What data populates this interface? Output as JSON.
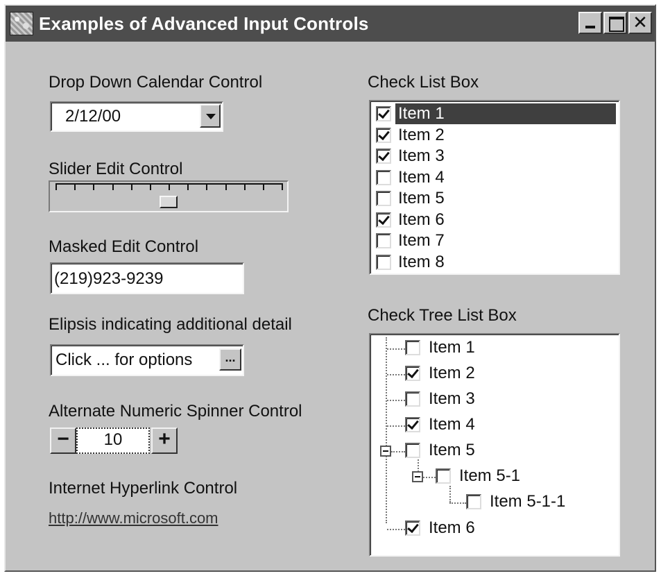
{
  "window": {
    "title": "Examples of Advanced Input Controls"
  },
  "date_control": {
    "label": "Drop Down Calendar Control",
    "value": "2/12/00"
  },
  "slider_control": {
    "label": "Slider Edit Control",
    "tick_count": 13,
    "position_fraction": 0.5
  },
  "masked_edit": {
    "label": "Masked Edit Control",
    "value": "(219)923-9239"
  },
  "ellipsis_control": {
    "label": "Elipsis indicating additional detail",
    "value": "Click ... for options",
    "button_label": "..."
  },
  "spinner": {
    "label": "Alternate Numeric Spinner Control",
    "value": "10",
    "minus_label": "−",
    "plus_label": "+"
  },
  "hyperlink": {
    "label": "Internet Hyperlink Control",
    "url": "http://www.microsoft.com"
  },
  "check_list_box": {
    "label": "Check List Box",
    "items": [
      {
        "label": "Item 1",
        "checked": true,
        "selected": true
      },
      {
        "label": "Item 2",
        "checked": true,
        "selected": false
      },
      {
        "label": "Item 3",
        "checked": true,
        "selected": false
      },
      {
        "label": "Item 4",
        "checked": false,
        "selected": false
      },
      {
        "label": "Item 5",
        "checked": false,
        "selected": false
      },
      {
        "label": "Item 6",
        "checked": true,
        "selected": false
      },
      {
        "label": "Item 7",
        "checked": false,
        "selected": false
      },
      {
        "label": "Item 8",
        "checked": false,
        "selected": false
      }
    ]
  },
  "check_tree_list_box": {
    "label": "Check Tree List Box",
    "items": [
      {
        "label": "Item 1",
        "checked": false
      },
      {
        "label": "Item 2",
        "checked": true
      },
      {
        "label": "Item 3",
        "checked": false
      },
      {
        "label": "Item 4",
        "checked": true
      },
      {
        "label": "Item 5",
        "checked": false,
        "expanded": true
      },
      {
        "label": "Item 5-1",
        "checked": false,
        "expanded": true
      },
      {
        "label": "Item 5-1-1",
        "checked": false
      },
      {
        "label": "Item 6",
        "checked": true
      }
    ]
  },
  "colors": {
    "window_bg": "#c4c4c4",
    "titlebar_bg": "#4d4d4d",
    "selection_bg": "#3f3f3f"
  }
}
